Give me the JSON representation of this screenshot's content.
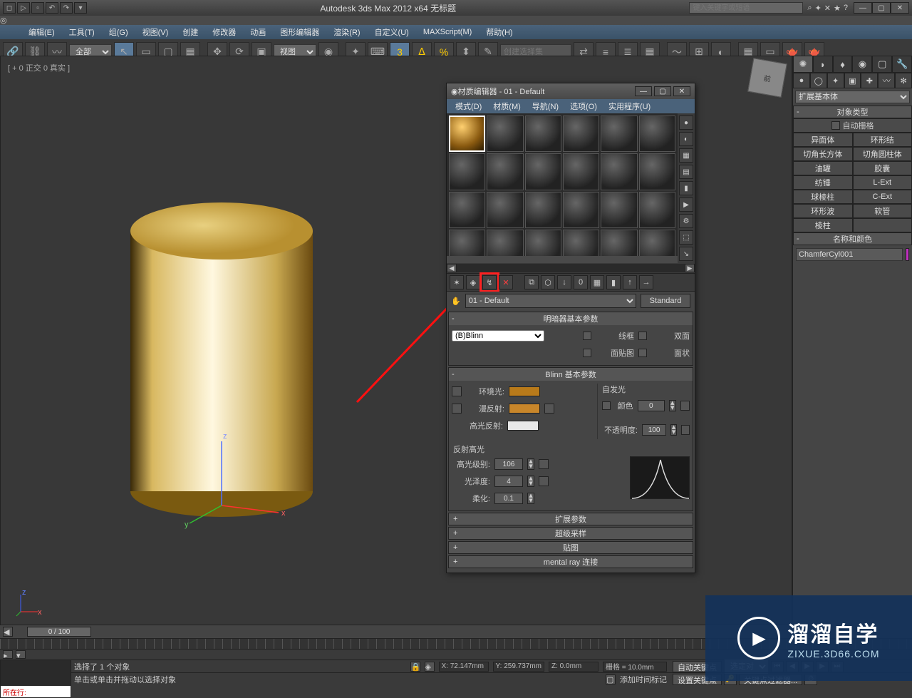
{
  "titlebar": {
    "app_title": "Autodesk 3ds Max 2012 x64   无标题",
    "search_placeholder": "键入关键字或短语",
    "qat_icons": [
      "new",
      "open",
      "save",
      "undo",
      "redo"
    ]
  },
  "menu": {
    "items": [
      "编辑(E)",
      "工具(T)",
      "组(G)",
      "视图(V)",
      "创建",
      "修改器",
      "动画",
      "图形编辑器",
      "渲染(R)",
      "自定义(U)",
      "MAXScript(M)",
      "帮助(H)"
    ]
  },
  "maintoolbar": {
    "selection_filter": "全部",
    "ref_coord": "视图",
    "named_sel_placeholder": "创建选择集"
  },
  "viewport": {
    "label": "[ + 0 正交 0 真实 ]",
    "axes": {
      "x": "x",
      "y": "y",
      "z": "z"
    },
    "cube": "前"
  },
  "cmdpanel": {
    "dropdown": "扩展基本体",
    "object_type_hdr": "对象类型",
    "autogrid": "自动栅格",
    "buttons": [
      [
        "异面体",
        "环形结"
      ],
      [
        "切角长方体",
        "切角圆柱体"
      ],
      [
        "油罐",
        "胶囊"
      ],
      [
        "纺锤",
        "L-Ext"
      ],
      [
        "球棱柱",
        "C-Ext"
      ],
      [
        "环形波",
        "软管"
      ],
      [
        "棱柱",
        ""
      ]
    ],
    "name_color_hdr": "名称和颜色",
    "obj_name": "ChamferCyl001"
  },
  "mateditor": {
    "title": "材质编辑器 - 01 - Default",
    "menu": [
      "模式(D)",
      "材质(M)",
      "导航(N)",
      "选项(O)",
      "实用程序(U)"
    ],
    "picker_tooltip": "从对象拾取",
    "mat_name": "01 - Default",
    "mat_type": "Standard",
    "shader_hdr": "明暗器基本参数",
    "shader": "(B)Blinn",
    "opts": {
      "wire": "线框",
      "two": "双面",
      "facemap": "面贴图",
      "faceted": "面状"
    },
    "blinn_hdr": "Blinn 基本参数",
    "labels": {
      "ambient": "环境光:",
      "diffuse": "漫反射:",
      "specular": "高光反射:",
      "selfillum_grp": "自发光",
      "color": "颜色",
      "opacity": "不透明度:",
      "spec_hdr": "反射高光",
      "spec_level": "高光级别:",
      "gloss": "光泽度:",
      "soften": "柔化:"
    },
    "values": {
      "selfillum": "0",
      "opacity": "100",
      "spec_level": "106",
      "gloss": "4",
      "soften": "0.1"
    },
    "colors": {
      "ambient": "#b87a1a",
      "diffuse": "#c8862a",
      "specular": "#e8e8e8"
    },
    "collapsed": [
      "扩展参数",
      "超级采样",
      "贴图",
      "mental ray 连接"
    ]
  },
  "bottom": {
    "time_label": "0 / 100",
    "sel_text": "选择了 1 个对象",
    "hint": "单击或单击并拖动以选择对象",
    "add_time_tag": "添加时间标记",
    "script_prompt": "所在行:",
    "x": "X: 72.147mm",
    "y": "Y: 259.737mm",
    "z": "Z: 0.0mm",
    "grid": "栅格 = 10.0mm",
    "autokey": "自动关键点",
    "setkey": "设置关键点",
    "sel_label": "选定对",
    "keyfilter": "关键点过滤器..."
  },
  "watermark": {
    "big": "溜溜自学",
    "small": "ZIXUE.3D66.COM"
  }
}
